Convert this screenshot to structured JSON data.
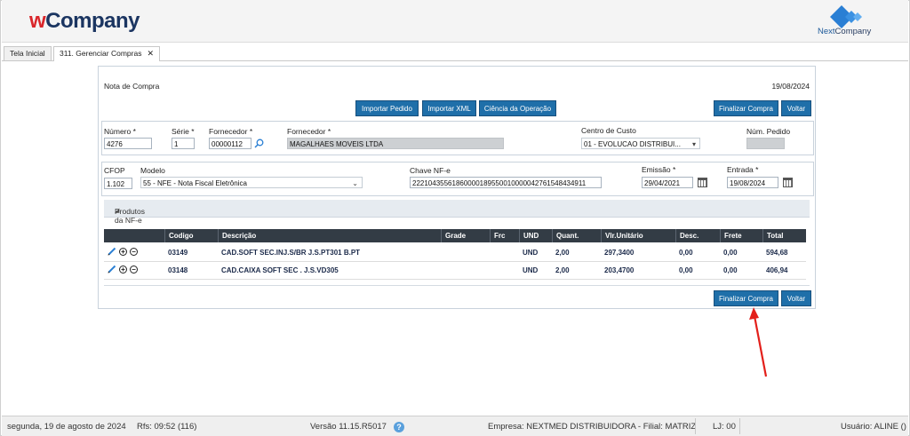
{
  "header": {
    "logo_w": "w",
    "logo_company": "Company",
    "right_logo_next": "Next",
    "right_logo_company": "Company"
  },
  "tabs": [
    {
      "label": "Tela Inicial"
    },
    {
      "label": "311. Gerenciar Compras",
      "close": "✕"
    }
  ],
  "form": {
    "title": "Nota de Compra",
    "date": "19/08/2024",
    "buttons": {
      "import_order": "Importar Pedido",
      "import_xml": "Importar XML",
      "operation_ack": "Ciência da Operação",
      "finalize_top": "Finalizar Compra",
      "back_top": "Voltar",
      "finalize_bottom": "Finalizar Compra",
      "back_bottom": "Voltar"
    },
    "numero": {
      "label": "Número *",
      "value": "4276"
    },
    "serie": {
      "label": "Série *",
      "value": "1"
    },
    "fornecedor_code": {
      "label": "Fornecedor *",
      "value": "00000112"
    },
    "fornecedor_name": {
      "label": "Fornecedor *",
      "value": "MAGALHAES MOVEIS LTDA"
    },
    "centro_custo": {
      "label": "Centro de Custo",
      "value": "01 - EVOLUCAO DISTRIBUI..."
    },
    "num_pedido": {
      "label": "Núm. Pedido",
      "value": ""
    },
    "cfop": {
      "label": "CFOP",
      "value": "1.102"
    },
    "modelo": {
      "label": "Modelo",
      "value": "55 - NFE - Nota Fiscal Eletrônica"
    },
    "chave": {
      "label": "Chave NF-e",
      "value": "22210435561860000189550010000042761548434911"
    },
    "emissao": {
      "label": "Emissão *",
      "value": "29/04/2021"
    },
    "entrada": {
      "label": "Entrada *",
      "value": "19/08/2024"
    },
    "section_title": "Produtos da NF-e"
  },
  "table": {
    "headers": [
      "Codigo",
      "Descrição",
      "Grade",
      "Frc",
      "UND",
      "Quant.",
      "Vlr.Unitário",
      "Desc.",
      "Frete",
      "Total"
    ],
    "rows": [
      {
        "codigo": "03149",
        "descricao": "CAD.SOFT SEC.INJ.S/BR J.S.PT301 B.PT",
        "grade": "",
        "frc": "",
        "und": "UND",
        "quant": "2,00",
        "vlr": "297,3400",
        "desc": "0,00",
        "frete": "0,00",
        "total": "594,68"
      },
      {
        "codigo": "03148",
        "descricao": "CAD.CAIXA SOFT SEC . J.S.VD305",
        "grade": "",
        "frc": "",
        "und": "UND",
        "quant": "2,00",
        "vlr": "203,4700",
        "desc": "0,00",
        "frete": "0,00",
        "total": "406,94"
      }
    ]
  },
  "status": {
    "date_text": "segunda, 19 de agosto de 2024",
    "rfs": "Rfs: 09:52 (116)",
    "version": "Versão 11.15.R5017",
    "help": "?",
    "empresa": "Empresa: NEXTMED DISTRIBUIDORA - Filial: MATRIZ",
    "lj": "LJ: 00",
    "usuario": "Usuário: ALINE ()"
  },
  "colors": {
    "button_blue": "#1f6fa9",
    "table_header": "#333c45",
    "annotation_arrow": "#e3201b"
  }
}
